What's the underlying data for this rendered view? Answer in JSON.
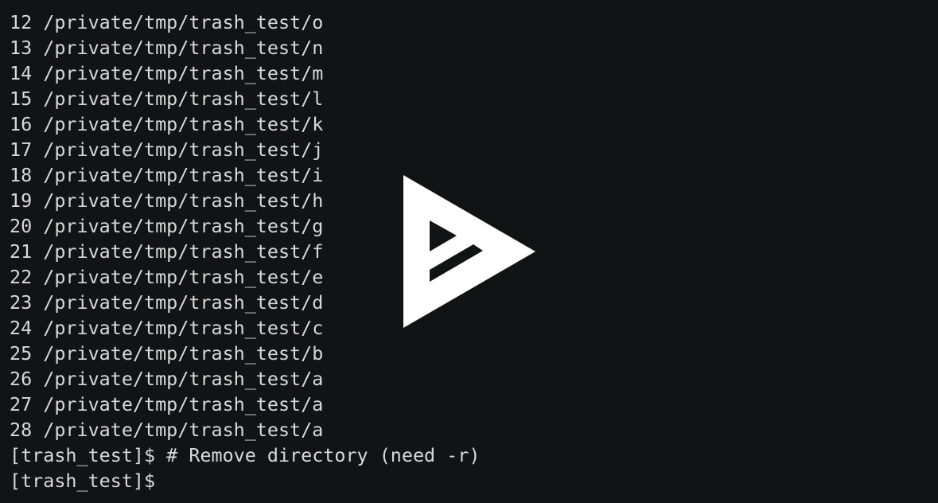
{
  "terminal": {
    "lines": [
      "12 /private/tmp/trash_test/o",
      "13 /private/tmp/trash_test/n",
      "14 /private/tmp/trash_test/m",
      "15 /private/tmp/trash_test/l",
      "16 /private/tmp/trash_test/k",
      "17 /private/tmp/trash_test/j",
      "18 /private/tmp/trash_test/i",
      "19 /private/tmp/trash_test/h",
      "20 /private/tmp/trash_test/g",
      "21 /private/tmp/trash_test/f",
      "22 /private/tmp/trash_test/e",
      "23 /private/tmp/trash_test/d",
      "24 /private/tmp/trash_test/c",
      "25 /private/tmp/trash_test/b",
      "26 /private/tmp/trash_test/a",
      "27 /private/tmp/trash_test/a",
      "28 /private/tmp/trash_test/a",
      "[trash_test]$ # Remove directory (need -r)",
      "[trash_test]$ "
    ]
  },
  "overlay": {
    "icon": "asciinema-play-icon"
  },
  "colors": {
    "background": "#121314",
    "text": "#d9d9d9",
    "play_icon": "#ffffff"
  }
}
